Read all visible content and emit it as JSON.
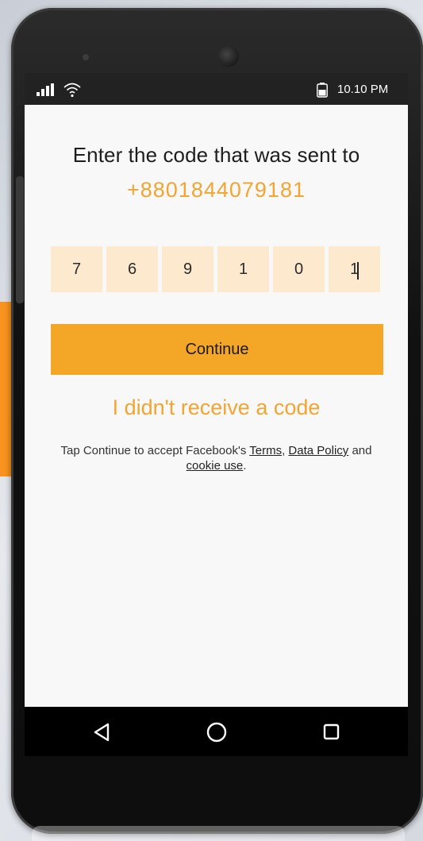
{
  "status_bar": {
    "time": "10.10 PM",
    "icons": [
      "signal-icon",
      "wifi-icon",
      "battery-icon"
    ]
  },
  "verification": {
    "heading": "Enter the code that was sent to",
    "phone_number": "+8801844079181",
    "code_digits": [
      "7",
      "6",
      "9",
      "1",
      "0",
      "1"
    ],
    "continue_label": "Continue",
    "resend_label": "I didn't receive a code"
  },
  "legal": {
    "prefix": "Tap Continue to accept Facebook's ",
    "terms": "Terms",
    "comma": ", ",
    "data_policy": "Data Policy",
    "and": " and ",
    "cookie_use": "cookie use",
    "suffix": "."
  },
  "nav_bar": {
    "icons": [
      "back-icon",
      "home-icon",
      "recent-apps-icon"
    ]
  },
  "colors": {
    "accent": "#f4a627",
    "link_orange": "#f2a531",
    "code_cell_bg": "#fde9cd",
    "status_bar_bg": "#222222",
    "nav_bar_bg": "#000000",
    "screen_bg": "#f8f8f8"
  }
}
